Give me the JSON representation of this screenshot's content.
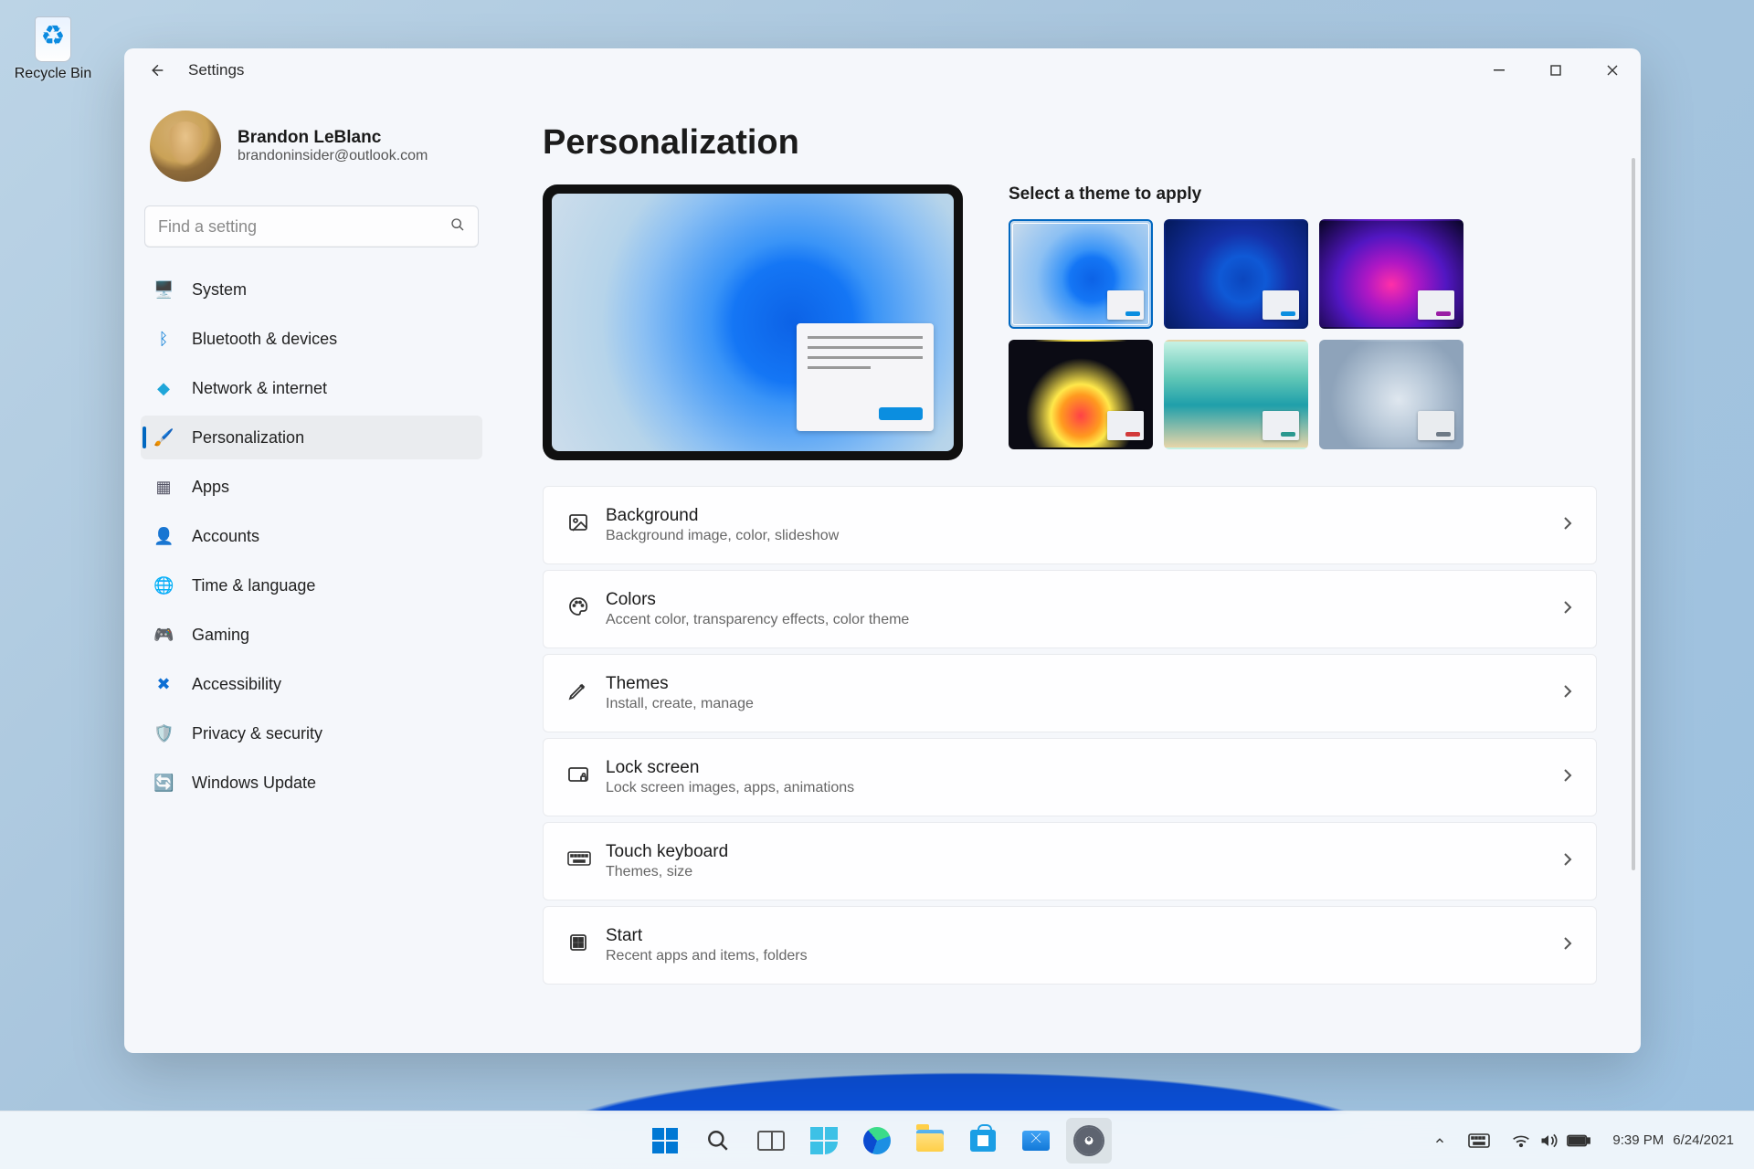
{
  "desktop": {
    "recycle_bin": "Recycle Bin"
  },
  "window": {
    "title": "Settings",
    "user_name": "Brandon LeBlanc",
    "user_email": "brandoninsider@outlook.com",
    "search_placeholder": "Find a setting",
    "page_title": "Personalization"
  },
  "nav": {
    "items": [
      {
        "icon": "🖥️",
        "label": "System",
        "color": "#0078d4"
      },
      {
        "icon": "ᛒ",
        "label": "Bluetooth & devices",
        "color": "#0078d4"
      },
      {
        "icon": "◆",
        "label": "Network & internet",
        "color": "#1fa6d9"
      },
      {
        "icon": "🖌️",
        "label": "Personalization",
        "active": true
      },
      {
        "icon": "▦",
        "label": "Apps",
        "color": "#556"
      },
      {
        "icon": "👤",
        "label": "Accounts",
        "color": "#1ea765"
      },
      {
        "icon": "🌐",
        "label": "Time & language",
        "color": "#2fa2da"
      },
      {
        "icon": "🎮",
        "label": "Gaming",
        "color": "#8e8e98"
      },
      {
        "icon": "✖",
        "label": "Accessibility",
        "color": "#0d6fd4"
      },
      {
        "icon": "🛡️",
        "label": "Privacy & security",
        "color": "#9fa4aa"
      },
      {
        "icon": "🔄",
        "label": "Windows Update",
        "color": "#0f8fe0"
      }
    ]
  },
  "themes": {
    "title": "Select a theme to apply",
    "tiles": [
      {
        "bg": "radial-gradient(circle at 58% 55%, #0c62e6 0%, #1476f5 22%, #3a94f7 30%, #8cc0f3 55%, #cdddeb 100%)",
        "accent": "#0b8ee0",
        "note": "#f2f2f5",
        "selected": true
      },
      {
        "bg": "radial-gradient(circle at 55% 55%, #0b46be 0%, #0f59d6 24%, #1530a8 48%, #041a5c 100%)",
        "accent": "#0b8ee0",
        "note": "#eef0f4"
      },
      {
        "bg": "radial-gradient(ellipse at 50% 60%, #ff2fa8 0%, #b017c4 25%, #5216c2 55%, #0a0528 100%)",
        "accent": "#9a1ea5",
        "note": "#eef0f4"
      },
      {
        "bg": "radial-gradient(ellipse at 50% 70%, #ff4147 0%, #ff9a1f 20%, #ffe84a 30%, #0b0b14 55%)",
        "accent": "#d23a3a",
        "note": "#eef0f4"
      },
      {
        "bg": "linear-gradient(180deg, #c7f2e4 0%, #5ec6b6 35%, #1f9faa 60%, #e7d5a9 100%)",
        "accent": "#2a988f",
        "note": "#eef0f4"
      },
      {
        "bg": "radial-gradient(circle at 55% 55%, #dfe7ef 0%, #b8c8d8 35%, #8ea3ba 70%)",
        "accent": "#6e7a86",
        "note": "#e9ecef"
      }
    ]
  },
  "preview": {
    "accent": "#0b8ee0"
  },
  "cards": [
    {
      "icon": "image",
      "title": "Background",
      "sub": "Background image, color, slideshow"
    },
    {
      "icon": "palette",
      "title": "Colors",
      "sub": "Accent color, transparency effects, color theme"
    },
    {
      "icon": "pen",
      "title": "Themes",
      "sub": "Install, create, manage"
    },
    {
      "icon": "lock",
      "title": "Lock screen",
      "sub": "Lock screen images, apps, animations"
    },
    {
      "icon": "keyboard",
      "title": "Touch keyboard",
      "sub": "Themes, size"
    },
    {
      "icon": "start",
      "title": "Start",
      "sub": "Recent apps and items, folders"
    }
  ],
  "tray": {
    "time": "9:39 PM",
    "date": "6/24/2021"
  }
}
